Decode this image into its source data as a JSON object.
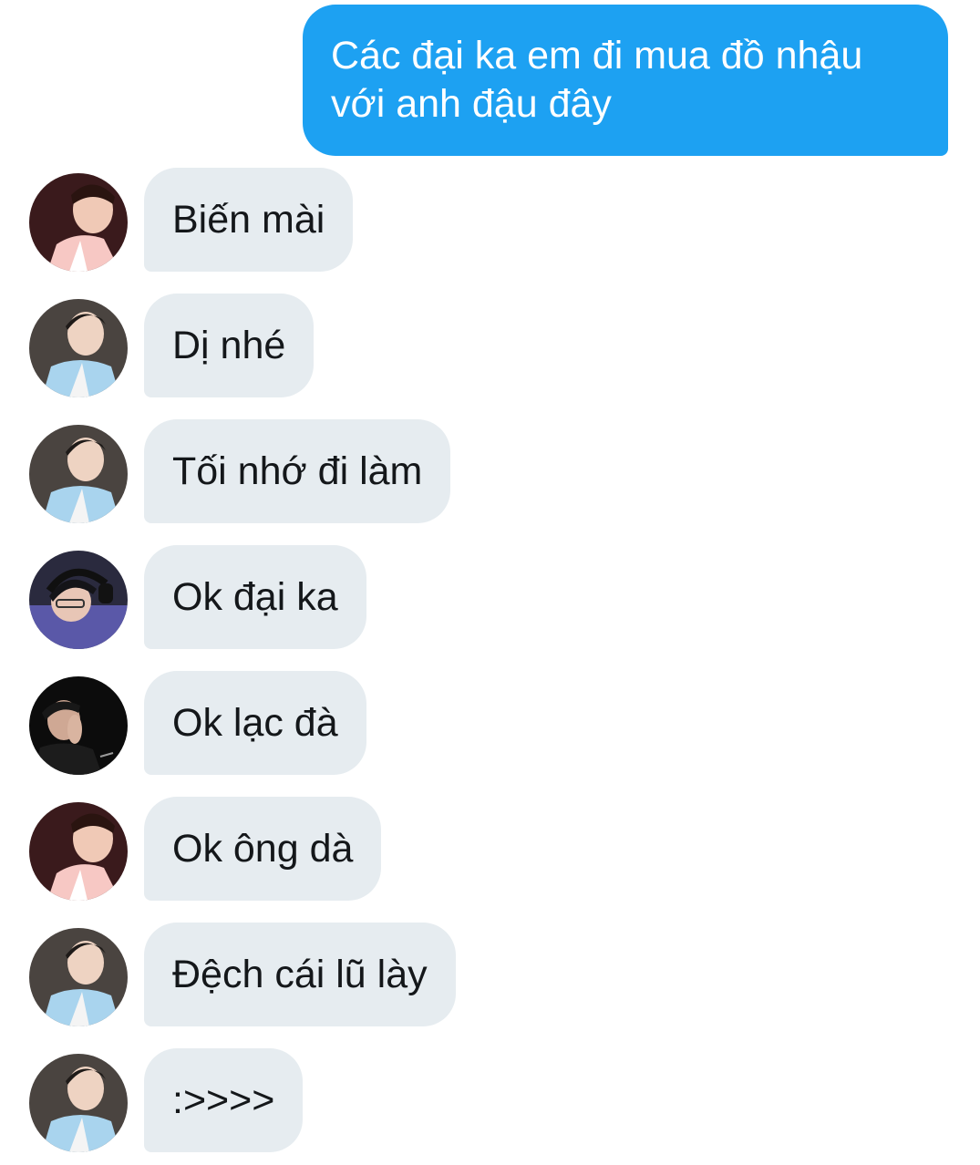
{
  "colors": {
    "outgoing_bubble": "#1da1f2",
    "incoming_bubble": "#e6ecf0",
    "incoming_text": "#14171a",
    "outgoing_text": "#ffffff"
  },
  "outgoing_message": {
    "line1": "Các đại ka em đi mua đồ nhậu",
    "line2": "với anh đậu đây"
  },
  "messages": [
    {
      "text": "Biến mài",
      "avatar": "avatar-pink-hanbok"
    },
    {
      "text": "Dị nhé",
      "avatar": "avatar-blue-hanbok"
    },
    {
      "text": "Tối nhớ đi làm",
      "avatar": "avatar-blue-hanbok"
    },
    {
      "text": "Ok đại ka",
      "avatar": "avatar-headset-gamer"
    },
    {
      "text": "Ok lạc đà",
      "avatar": "avatar-dark-portrait"
    },
    {
      "text": "Ok ông dà",
      "avatar": "avatar-pink-hanbok"
    },
    {
      "text": "Đệch cái lũ lày",
      "avatar": "avatar-blue-hanbok"
    },
    {
      "text": ":>>>>",
      "avatar": "avatar-blue-hanbok"
    }
  ]
}
